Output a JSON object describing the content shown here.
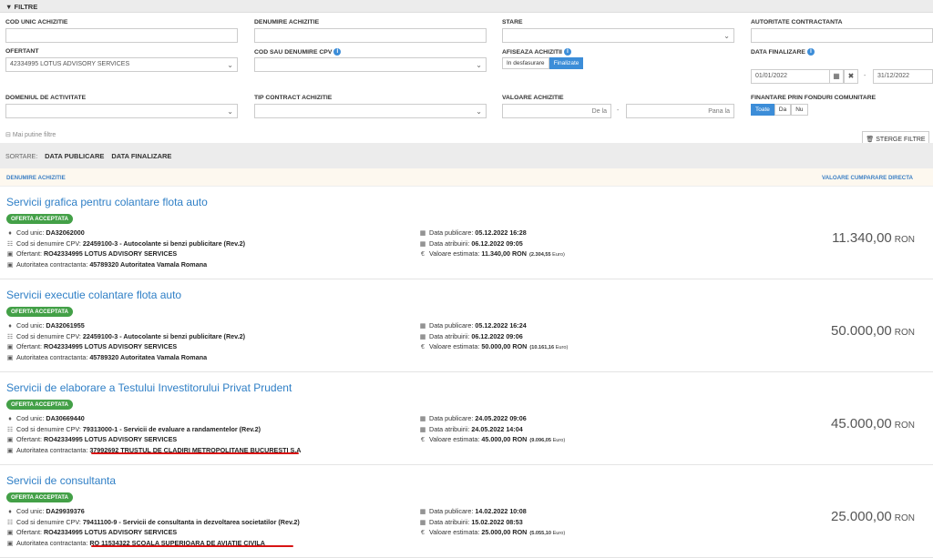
{
  "filters": {
    "header": "FILTRE",
    "cod_unic": {
      "label": "COD UNIC ACHIZITIE",
      "value": ""
    },
    "denumire": {
      "label": "DENUMIRE ACHIZITIE",
      "value": ""
    },
    "stare": {
      "label": "STARE",
      "value": ""
    },
    "autoritate": {
      "label": "AUTORITATE CONTRACTANTA",
      "value": ""
    },
    "ofertant": {
      "label": "OFERTANT",
      "value": "42334995 LOTUS ADVISORY SERVICES"
    },
    "cpv": {
      "label": "COD SAU DENUMIRE CPV",
      "value": ""
    },
    "afiseaza": {
      "label": "AFISEAZA ACHIZITII",
      "options": [
        "In desfasurare",
        "Finalizate"
      ],
      "selected": "Finalizate"
    },
    "data_finalizare": {
      "label": "DATA FINALIZARE",
      "from": "01/01/2022",
      "to": "31/12/2022",
      "separator": "-"
    },
    "domeniu": {
      "label": "DOMENIUL DE ACTIVITATE",
      "value": ""
    },
    "tip_contract": {
      "label": "TIP CONTRACT ACHIZITIE",
      "value": ""
    },
    "valoare": {
      "label": "VALOARE ACHIZITIE",
      "from_placeholder": "De la",
      "to_placeholder": "Pana la",
      "separator": "-"
    },
    "finantare": {
      "label": "FINANTARE PRIN FONDURI COMUNITARE",
      "options": [
        "Toate",
        "Da",
        "Nu"
      ],
      "selected": "Toate"
    },
    "less_filters": "Mai putine filtre",
    "clear_button": "STERGE FILTRE"
  },
  "sort": {
    "label": "SORTARE:",
    "options": [
      "DATA PUBLICARE",
      "DATA FINALIZARE"
    ]
  },
  "columns": {
    "left": "DENUMIRE ACHIZITIE",
    "right": "VALOARE CUMPARARE DIRECTA"
  },
  "labels": {
    "cod_unic": "Cod unic:",
    "cpv": "Cod si denumire CPV:",
    "ofertant": "Ofertant:",
    "autoritate": "Autoritatea contractanta:",
    "data_publicare": "Data publicare:",
    "data_atribuirii": "Data atribuirii:",
    "valoare_estimata": "Valoare estimata:",
    "ron": "RON",
    "euro": "Euro"
  },
  "results": [
    {
      "title": "Servicii grafica pentru colantare flota auto",
      "status": "OFERTA ACCEPTATA",
      "cod_unic": "DA32062000",
      "cpv": "22459100-3 - Autocolante si benzi publicitare (Rev.2)",
      "ofertant": "RO42334995 LOTUS ADVISORY SERVICES",
      "autoritate": "45789320 Autoritatea Vamala Romana",
      "data_publicare": "05.12.2022 16:28",
      "data_atribuirii": "06.12.2022 09:05",
      "valoare_estimata": "11.340,00",
      "valoare_euro": "(2.304,55",
      "valoare": "11.340,00",
      "underlined": false
    },
    {
      "title": "Servicii executie colantare flota auto",
      "status": "OFERTA ACCEPTATA",
      "cod_unic": "DA32061955",
      "cpv": "22459100-3 - Autocolante si benzi publicitare (Rev.2)",
      "ofertant": "RO42334995 LOTUS ADVISORY SERVICES",
      "autoritate": "45789320 Autoritatea Vamala Romana",
      "data_publicare": "05.12.2022 16:24",
      "data_atribuirii": "06.12.2022 09:06",
      "valoare_estimata": "50.000,00",
      "valoare_euro": "(10.161,16",
      "valoare": "50.000,00",
      "underlined": false
    },
    {
      "title": "Servicii de elaborare a Testului Investitorului Privat Prudent",
      "status": "OFERTA ACCEPTATA",
      "cod_unic": "DA30669440",
      "cpv": "79313000-1 - Servicii de evaluare a randamentelor (Rev.2)",
      "ofertant": "RO42334995 LOTUS ADVISORY SERVICES",
      "autoritate": "37992692 TRUSTUL DE CLADIRI METROPOLITANE BUCURESTI S.A",
      "data_publicare": "24.05.2022 09:06",
      "data_atribuirii": "24.05.2022 14:04",
      "valoare_estimata": "45.000,00",
      "valoare_euro": "(9.096,05",
      "valoare": "45.000,00",
      "underlined": true
    },
    {
      "title": "Servicii de consultanta",
      "status": "OFERTA ACCEPTATA",
      "cod_unic": "DA29939376",
      "cpv": "79411100-9 - Servicii de consultanta in dezvoltarea societatilor (Rev.2)",
      "ofertant": "RO42334995 LOTUS ADVISORY SERVICES",
      "autoritate": "RO 11534322 SCOALA SUPERIOARA DE AVIATIE CIVILA",
      "data_publicare": "14.02.2022 10:08",
      "data_atribuirii": "15.02.2022 08:53",
      "valoare_estimata": "25.000,00",
      "valoare_euro": "(5.055,10",
      "valoare": "25.000,00",
      "underlined": true
    }
  ],
  "colors": {
    "accent": "#3c8dd8",
    "title_link": "#2f7fc6",
    "badge": "#43a047",
    "underline": "#d81414"
  }
}
